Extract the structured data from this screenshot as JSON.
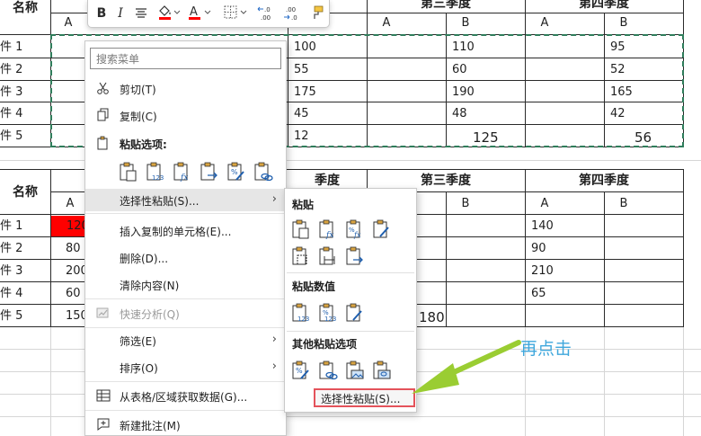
{
  "mini_toolbar": {
    "bold": "B",
    "italic": "I",
    "font_color_glyph": "A",
    "dec_increase": "←.0\n.00",
    "dec_decrease": ".00\n→.0",
    "icons": [
      "bold-icon",
      "italic-icon",
      "align-icon",
      "fill-color-icon",
      "font-color-icon",
      "border-icon",
      "increase-decimal-icon",
      "decrease-decimal-icon",
      "format-painter-icon"
    ],
    "fill_color": "#ff0000",
    "font_color": "#ff0000"
  },
  "table1": {
    "header_name": "名称",
    "q3": "第三季度",
    "q4": "第四季度",
    "sub": [
      "A",
      "A",
      "B",
      "A",
      "B"
    ],
    "rows": [
      {
        "name": "件 1",
        "q2b": "100",
        "q3b": "110",
        "q4b": "95"
      },
      {
        "name": "件 2",
        "q2b": "55",
        "q3b": "60",
        "q4b": "52"
      },
      {
        "name": "件 3",
        "q2b": "175",
        "q3b": "190",
        "q4b": "165"
      },
      {
        "name": "件 4",
        "q2b": "45",
        "q3b": "48",
        "q4b": "42"
      },
      {
        "name": "件 5",
        "q2b": "12",
        "q3b": "125",
        "q4b": "56"
      }
    ]
  },
  "table2": {
    "header_name": "名称",
    "q2": "季度",
    "q3": "第三季度",
    "q4": "第四季度",
    "sub": [
      "A",
      "B",
      "A",
      "B"
    ],
    "rows": [
      {
        "name": "件 1",
        "q1a": "120",
        "q4a": "140"
      },
      {
        "name": "件 2",
        "q1a": "80",
        "q4a": "90"
      },
      {
        "name": "件 3",
        "q1a": "200",
        "q4a": "210"
      },
      {
        "name": "件 4",
        "q1a": "60",
        "q4a": "65"
      },
      {
        "name": "件 5",
        "q1a": "150",
        "q3a": "180"
      }
    ],
    "highlight_color": "#ff0000"
  },
  "context_menu": {
    "search_placeholder": "搜索菜单",
    "cut": "剪切(T)",
    "copy": "复制(C)",
    "paste_options": "粘贴选项:",
    "paste_special": "选择性粘贴(S)...",
    "insert_copied": "插入复制的单元格(E)...",
    "delete": "删除(D)...",
    "clear": "清除内容(N)",
    "quick_analysis": "快速分析(Q)",
    "filter": "筛选(E)",
    "sort": "排序(O)",
    "get_data": "从表格/区域获取数据(G)...",
    "new_comment": "新建批注(M)",
    "submenu_arrow": "›"
  },
  "submenu": {
    "paste": "粘贴",
    "paste_values": "粘贴数值",
    "other_paste": "其他粘贴选项",
    "paste_special": "选择性粘贴(S)..."
  },
  "annotation": {
    "text": "再点击",
    "text_color": "#3fa7dc",
    "arrow_color": "#9acd32",
    "box_color": "#e4535b"
  }
}
